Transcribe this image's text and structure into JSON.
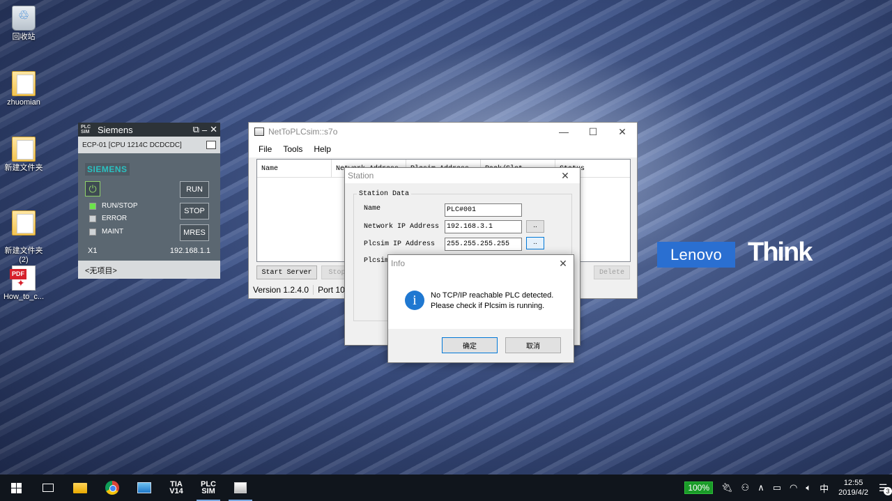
{
  "desktop": {
    "icons": [
      {
        "label": "回收站",
        "icon": "recycle-bin-icon"
      },
      {
        "label": "zhuomian",
        "icon": "folder-icon"
      },
      {
        "label": "新建文件夹",
        "icon": "folder-icon"
      },
      {
        "label": "新建文件夹\n(2)",
        "icon": "folder-icon"
      },
      {
        "label": "How_to_c...",
        "icon": "pdf-icon"
      }
    ]
  },
  "plcsim": {
    "title": "Siemens",
    "logo_text": "PLC SIM",
    "cpu": "ECP-01 [CPU 1214C DCDCDC]",
    "brand": "SIEMENS",
    "leds": [
      {
        "label": "RUN/STOP",
        "color": "#6be34a"
      },
      {
        "label": "ERROR",
        "color": "#cfd3d6"
      },
      {
        "label": "MAINT",
        "color": "#cfd3d6"
      }
    ],
    "buttons": {
      "run": "RUN",
      "stop": "STOP",
      "mres": "MRES"
    },
    "interface": "X1",
    "ip": "192.168.1.1",
    "footer": "<无项目>"
  },
  "netwin": {
    "title": "NetToPLCsim::s7o",
    "menu": [
      "File",
      "Tools",
      "Help"
    ],
    "columns": [
      "Name",
      "Network Address",
      "Plcsim Address",
      "Rack/Slot",
      "Status"
    ],
    "buttons": {
      "start": "Start Server",
      "stop": "Stop Server",
      "delete": "Delete"
    },
    "status": {
      "version": "Version 1.2.4.0",
      "port": "Port 102"
    }
  },
  "station": {
    "title": "Station",
    "group": "Station Data",
    "fields": {
      "name_label": "Name",
      "name_value": "PLC#001",
      "network_label": "Network IP Address",
      "network_value": "192.168.3.1",
      "plcsim_label": "Plcsim IP Address",
      "plcsim_value": "255.255.255.255",
      "plcsim2_label": "Plcsim"
    },
    "dots": ".."
  },
  "info": {
    "title": "Info",
    "line1": "No TCP/IP reachable PLC detected.",
    "line2": "Please check if Plcsim is running.",
    "ok": "确定",
    "cancel": "取消"
  },
  "branding": {
    "lenovo": "Lenovo",
    "think": "Think"
  },
  "taskbar": {
    "tia": "TIA\nV14",
    "plc": "PLC\nSIM",
    "battery": "100%",
    "ime": "中",
    "time": "12:55",
    "date": "2019/4/2",
    "notifications": "3"
  }
}
